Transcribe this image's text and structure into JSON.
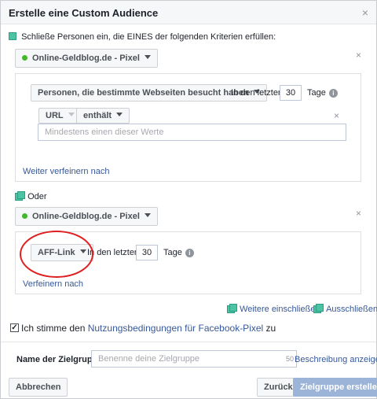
{
  "dialog": {
    "title": "Erstelle eine Custom Audience",
    "close": "×"
  },
  "criteria": {
    "intro": "Schließe Personen ein, die EINES der folgenden Kriterien erfüllen:"
  },
  "rule1": {
    "pixel_label": "Online-Geldblog.de - Pixel",
    "remove": "×",
    "condition_label": "Personen, die bestimmte Webseiten besucht haben",
    "in_den_letzten": "In den letzten",
    "days_value": "30",
    "tage": "Tage",
    "url_label": "URL",
    "operator_label": "enthält",
    "filter_remove": "×",
    "values_placeholder": "Mindestens einen dieser Werte",
    "refine_link": "Weiter verfeinern nach"
  },
  "oder": "Oder",
  "rule2": {
    "pixel_label": "Online-Geldblog.de - Pixel",
    "remove": "×",
    "event_label": "AFF-Link",
    "in_den_letzten": "In den letzten",
    "days_value": "30",
    "tage": "Tage",
    "refine_link": "Verfeinern nach"
  },
  "actions": {
    "include_more": "Weitere einschließen",
    "exclude": "Ausschließen"
  },
  "terms": {
    "prefix": "Ich stimme den",
    "link": "Nutzungsbedingungen für Facebook-Pixel",
    "suffix": "zu"
  },
  "audience_name": {
    "label": "Name der Zielgruppe",
    "placeholder": "Benenne deine Zielgruppe",
    "char_count": "50",
    "show_description": "Beschreibung anzeigen"
  },
  "footer": {
    "cancel": "Abbrechen",
    "back": "Zurück",
    "create": "Zielgruppe erstellen"
  },
  "colors": {
    "link": "#365899",
    "accent_green": "#4cc4a4",
    "primary_disabled": "#9cb4d8",
    "annotation_red": "#e02020"
  }
}
